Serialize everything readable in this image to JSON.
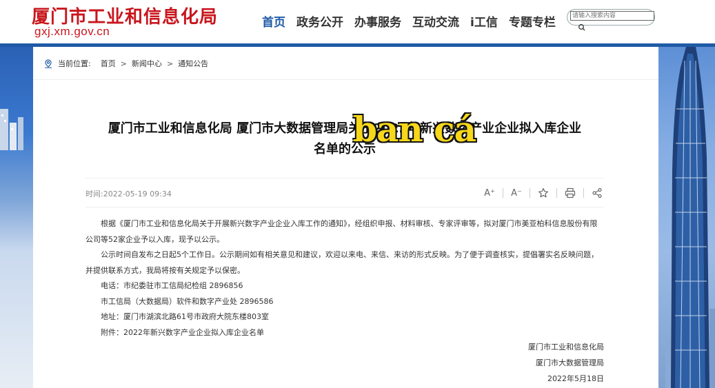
{
  "header": {
    "site_name": "厦门市工业和信息化局",
    "domain": "gxj.xm.gov.cn",
    "nav": [
      "首页",
      "政务公开",
      "办事服务",
      "互动交流",
      "i工信",
      "专题专栏"
    ],
    "search_placeholder": "请输入搜索内容"
  },
  "breadcrumb": {
    "label": "当前位置:",
    "items": [
      "首页",
      "新闻中心",
      "通知公告"
    ]
  },
  "article": {
    "title_line1": "厦门市工业和信息化局 厦门市大数据管理局关于2022年新兴数字产业企业拟入库企业",
    "title_line2": "名单的公示",
    "watermark": "ban cá",
    "time": "时间:2022-05-19 09:34",
    "tools": {
      "font_increase": "A⁺",
      "font_decrease": "A⁻"
    },
    "paragraphs": [
      "根据《厦门市工业和信息化局关于开展新兴数字产业企业入库工作的通知》，经组织申报、材料审核、专家评审等，拟对厦门市美亚柏科信息股份有限公司等52家企业予以入库，现予以公示。",
      "公示时间自发布之日起5个工作日。公示期间如有相关意见和建议，欢迎以来电、来信、来访的形式反映。为了便于调查核实，提倡署实名反映问题，并提供联系方式，我局将按有关规定予以保密。",
      "电话：市纪委驻市工信局纪检组 2896856",
      "市工信局（大数据局）软件和数字产业处 2896586",
      "地址：厦门市湖滨北路61号市政府大院东楼803室",
      "附件：2022年新兴数字产业企业拟入库企业名单"
    ],
    "signature": [
      "厦门市工业和信息化局",
      "厦门市大数据管理局",
      "2022年5月18日"
    ]
  },
  "colors": {
    "brand_red": "#c8161d",
    "nav_blue": "#1f5aa6",
    "watermark_yellow": "#f6d71a"
  }
}
